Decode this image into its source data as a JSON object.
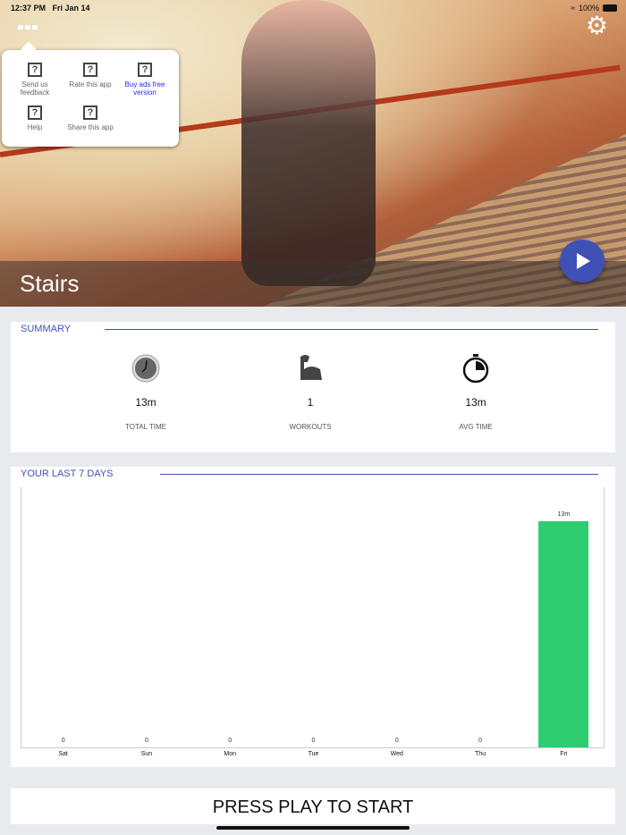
{
  "status_bar": {
    "time": "12:37 PM",
    "date": "Fri Jan 14",
    "battery": "100%"
  },
  "menu": {
    "items": [
      {
        "label": "Send us feedback",
        "icon": "question-icon"
      },
      {
        "label": "Rate this app",
        "icon": "question-icon"
      },
      {
        "label": "Buy ads free version",
        "icon": "question-icon"
      },
      {
        "label": "Help",
        "icon": "question-icon"
      },
      {
        "label": "Share this app",
        "icon": "question-icon"
      }
    ]
  },
  "hero": {
    "title": "Stairs"
  },
  "summary": {
    "header": "SUMMARY",
    "stats": [
      {
        "value": "13m",
        "label": "TOTAL TIME",
        "icon": "clock-icon"
      },
      {
        "value": "1",
        "label": "WORKOUTS",
        "icon": "muscle-icon"
      },
      {
        "value": "13m",
        "label": "AVG TIME",
        "icon": "stopwatch-icon"
      }
    ]
  },
  "chart_data": {
    "type": "bar",
    "title": "YOUR LAST 7 DAYS",
    "categories": [
      "Sat",
      "Sun",
      "Mon",
      "Tue",
      "Wed",
      "Thu",
      "Fri"
    ],
    "values": [
      0,
      0,
      0,
      0,
      0,
      0,
      13
    ],
    "value_labels": [
      "0",
      "0",
      "0",
      "0",
      "0",
      "0",
      "13m"
    ],
    "unit": "minutes",
    "ylim": [
      0,
      15
    ],
    "color": "#2ecc71"
  },
  "footer": {
    "press_label": "PRESS PLAY TO START"
  },
  "colors": {
    "accent": "#3f51b5",
    "bar": "#2ecc71"
  }
}
